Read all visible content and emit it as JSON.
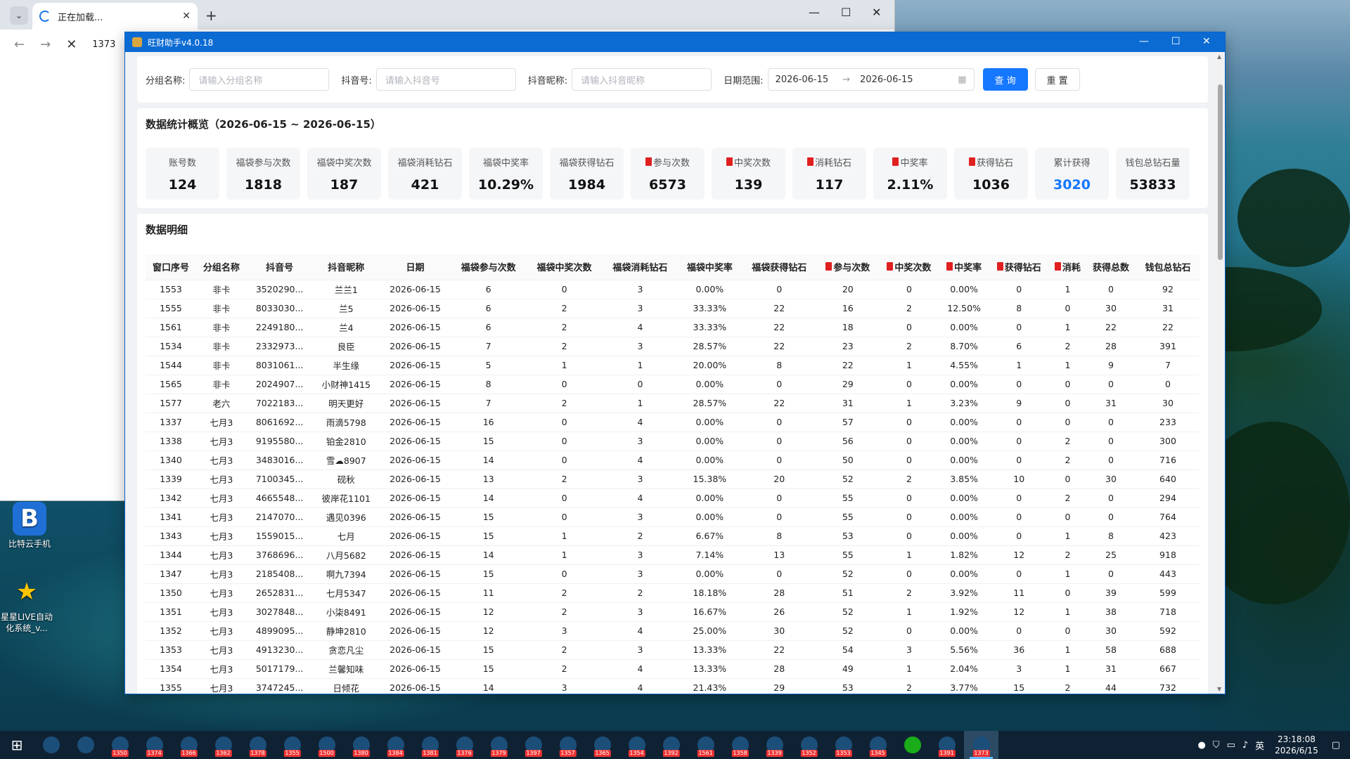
{
  "browser": {
    "tab_title": "正在加载...",
    "address": "1373"
  },
  "desktop_icons": [
    {
      "label": "比特云手机"
    },
    {
      "label": "星星LIVE自动化系统_v..."
    }
  ],
  "app": {
    "title": "旺财助手v4.0.18",
    "filters": {
      "group_label": "分组名称:",
      "group_placeholder": "请输入分组名称",
      "douyin_label": "抖音号:",
      "douyin_placeholder": "请输入抖音号",
      "nickname_label": "抖音昵称:",
      "nickname_placeholder": "请输入抖音昵称",
      "date_label": "日期范围:",
      "date_start": "2026-06-15",
      "date_end": "2026-06-15",
      "query_button": "查 询",
      "reset_button": "重 置"
    },
    "stats": {
      "title": "数据统计概览（2026-06-15 ~ 2026-06-15）",
      "items": [
        {
          "label": "账号数",
          "value": "124",
          "red": false,
          "blue": false
        },
        {
          "label": "福袋参与次数",
          "value": "1818",
          "red": false,
          "blue": false
        },
        {
          "label": "福袋中奖次数",
          "value": "187",
          "red": false,
          "blue": false
        },
        {
          "label": "福袋消耗钻石",
          "value": "421",
          "red": false,
          "blue": false
        },
        {
          "label": "福袋中奖率",
          "value": "10.29%",
          "red": false,
          "blue": false
        },
        {
          "label": "福袋获得钻石",
          "value": "1984",
          "red": false,
          "blue": false
        },
        {
          "label": "参与次数",
          "value": "6573",
          "red": true,
          "blue": false
        },
        {
          "label": "中奖次数",
          "value": "139",
          "red": true,
          "blue": false
        },
        {
          "label": "消耗钻石",
          "value": "117",
          "red": true,
          "blue": false
        },
        {
          "label": "中奖率",
          "value": "2.11%",
          "red": true,
          "blue": false
        },
        {
          "label": "获得钻石",
          "value": "1036",
          "red": true,
          "blue": false
        },
        {
          "label": "累计获得",
          "value": "3020",
          "red": false,
          "blue": true
        },
        {
          "label": "钱包总钻石量",
          "value": "53833",
          "red": false,
          "blue": false
        }
      ]
    },
    "detail": {
      "title": "数据明细",
      "columns": [
        {
          "label": "窗口序号",
          "red": false
        },
        {
          "label": "分组名称",
          "red": false
        },
        {
          "label": "抖音号",
          "red": false
        },
        {
          "label": "抖音昵称",
          "red": false
        },
        {
          "label": "日期",
          "red": false
        },
        {
          "label": "福袋参与次数",
          "red": false
        },
        {
          "label": "福袋中奖次数",
          "red": false
        },
        {
          "label": "福袋消耗钻石",
          "red": false
        },
        {
          "label": "福袋中奖率",
          "red": false
        },
        {
          "label": "福袋获得钻石",
          "red": false
        },
        {
          "label": "参与次数",
          "red": true
        },
        {
          "label": "中奖次数",
          "red": true
        },
        {
          "label": "中奖率",
          "red": true
        },
        {
          "label": "获得钻石",
          "red": true
        },
        {
          "label": "消耗",
          "red": true
        },
        {
          "label": "获得总数",
          "red": false
        },
        {
          "label": "钱包总钻石",
          "red": false
        }
      ],
      "rows": [
        [
          "1553",
          "非卡",
          "3520290...",
          "兰兰1",
          "2026-06-15",
          "6",
          "0",
          "3",
          "0.00%",
          "0",
          "20",
          "0",
          "0.00%",
          "0",
          "1",
          "0",
          "92"
        ],
        [
          "1555",
          "非卡",
          "8033030...",
          "兰5",
          "2026-06-15",
          "6",
          "2",
          "3",
          "33.33%",
          "22",
          "16",
          "2",
          "12.50%",
          "8",
          "0",
          "30",
          "31"
        ],
        [
          "1561",
          "非卡",
          "2249180...",
          "兰4",
          "2026-06-15",
          "6",
          "2",
          "4",
          "33.33%",
          "22",
          "18",
          "0",
          "0.00%",
          "0",
          "1",
          "22",
          "22"
        ],
        [
          "1534",
          "非卡",
          "2332973...",
          "良臣",
          "2026-06-15",
          "7",
          "2",
          "3",
          "28.57%",
          "22",
          "23",
          "2",
          "8.70%",
          "6",
          "2",
          "28",
          "391"
        ],
        [
          "1544",
          "非卡",
          "8031061...",
          "半生缘",
          "2026-06-15",
          "5",
          "1",
          "1",
          "20.00%",
          "8",
          "22",
          "1",
          "4.55%",
          "1",
          "1",
          "9",
          "7"
        ],
        [
          "1565",
          "非卡",
          "2024907...",
          "小财神1415",
          "2026-06-15",
          "8",
          "0",
          "0",
          "0.00%",
          "0",
          "29",
          "0",
          "0.00%",
          "0",
          "0",
          "0",
          "0"
        ],
        [
          "1577",
          "老六",
          "7022183...",
          "明天更好",
          "2026-06-15",
          "7",
          "2",
          "1",
          "28.57%",
          "22",
          "31",
          "1",
          "3.23%",
          "9",
          "0",
          "31",
          "30"
        ],
        [
          "1337",
          "七月3",
          "8061692...",
          "雨滴5798",
          "2026-06-15",
          "16",
          "0",
          "4",
          "0.00%",
          "0",
          "57",
          "0",
          "0.00%",
          "0",
          "0",
          "0",
          "233"
        ],
        [
          "1338",
          "七月3",
          "9195580...",
          "铂金2810",
          "2026-06-15",
          "15",
          "0",
          "3",
          "0.00%",
          "0",
          "56",
          "0",
          "0.00%",
          "0",
          "2",
          "0",
          "300"
        ],
        [
          "1340",
          "七月3",
          "3483016...",
          "雪☁8907",
          "2026-06-15",
          "14",
          "0",
          "4",
          "0.00%",
          "0",
          "50",
          "0",
          "0.00%",
          "0",
          "2",
          "0",
          "716"
        ],
        [
          "1339",
          "七月3",
          "7100345...",
          "砚秋",
          "2026-06-15",
          "13",
          "2",
          "3",
          "15.38%",
          "20",
          "52",
          "2",
          "3.85%",
          "10",
          "0",
          "30",
          "640"
        ],
        [
          "1342",
          "七月3",
          "4665548...",
          "彼岸花1101",
          "2026-06-15",
          "14",
          "0",
          "4",
          "0.00%",
          "0",
          "55",
          "0",
          "0.00%",
          "0",
          "2",
          "0",
          "294"
        ],
        [
          "1341",
          "七月3",
          "2147070...",
          "遇见0396",
          "2026-06-15",
          "15",
          "0",
          "3",
          "0.00%",
          "0",
          "55",
          "0",
          "0.00%",
          "0",
          "0",
          "0",
          "764"
        ],
        [
          "1343",
          "七月3",
          "1559015...",
          "七月",
          "2026-06-15",
          "15",
          "1",
          "2",
          "6.67%",
          "8",
          "53",
          "0",
          "0.00%",
          "0",
          "1",
          "8",
          "423"
        ],
        [
          "1344",
          "七月3",
          "3768696...",
          "八月5682",
          "2026-06-15",
          "14",
          "1",
          "3",
          "7.14%",
          "13",
          "55",
          "1",
          "1.82%",
          "12",
          "2",
          "25",
          "918"
        ],
        [
          "1347",
          "七月3",
          "2185408...",
          "啊九7394",
          "2026-06-15",
          "15",
          "0",
          "3",
          "0.00%",
          "0",
          "52",
          "0",
          "0.00%",
          "0",
          "1",
          "0",
          "443"
        ],
        [
          "1350",
          "七月3",
          "2652831...",
          "七月5347",
          "2026-06-15",
          "11",
          "2",
          "2",
          "18.18%",
          "28",
          "51",
          "2",
          "3.92%",
          "11",
          "0",
          "39",
          "599"
        ],
        [
          "1351",
          "七月3",
          "3027848...",
          "小柒8491",
          "2026-06-15",
          "12",
          "2",
          "3",
          "16.67%",
          "26",
          "52",
          "1",
          "1.92%",
          "12",
          "1",
          "38",
          "718"
        ],
        [
          "1352",
          "七月3",
          "4899095...",
          "静坤2810",
          "2026-06-15",
          "12",
          "3",
          "4",
          "25.00%",
          "30",
          "52",
          "0",
          "0.00%",
          "0",
          "0",
          "30",
          "592"
        ],
        [
          "1353",
          "七月3",
          "4913230...",
          "贪恋凡尘",
          "2026-06-15",
          "15",
          "2",
          "3",
          "13.33%",
          "22",
          "54",
          "3",
          "5.56%",
          "36",
          "1",
          "58",
          "688"
        ],
        [
          "1354",
          "七月3",
          "5017179...",
          "兰馨知味",
          "2026-06-15",
          "15",
          "2",
          "4",
          "13.33%",
          "28",
          "49",
          "1",
          "2.04%",
          "3",
          "1",
          "31",
          "667"
        ],
        [
          "1355",
          "七月3",
          "3747245...",
          "日倾花",
          "2026-06-15",
          "14",
          "3",
          "4",
          "21.43%",
          "29",
          "53",
          "2",
          "3.77%",
          "15",
          "2",
          "44",
          "732"
        ]
      ]
    }
  },
  "taskbar": {
    "items": [
      "",
      "",
      "1350",
      "1374",
      "1366",
      "1362",
      "1378",
      "1355",
      "1500",
      "1380",
      "1384",
      "1381",
      "1376",
      "1379",
      "1397",
      "1357",
      "1365",
      "1354",
      "1392",
      "1561",
      "1358",
      "1339",
      "1352",
      "1353",
      "1345",
      "",
      "1391",
      "1373"
    ],
    "clock_time": "23:18:08",
    "clock_date": "2026/6/15",
    "ime": "英"
  }
}
